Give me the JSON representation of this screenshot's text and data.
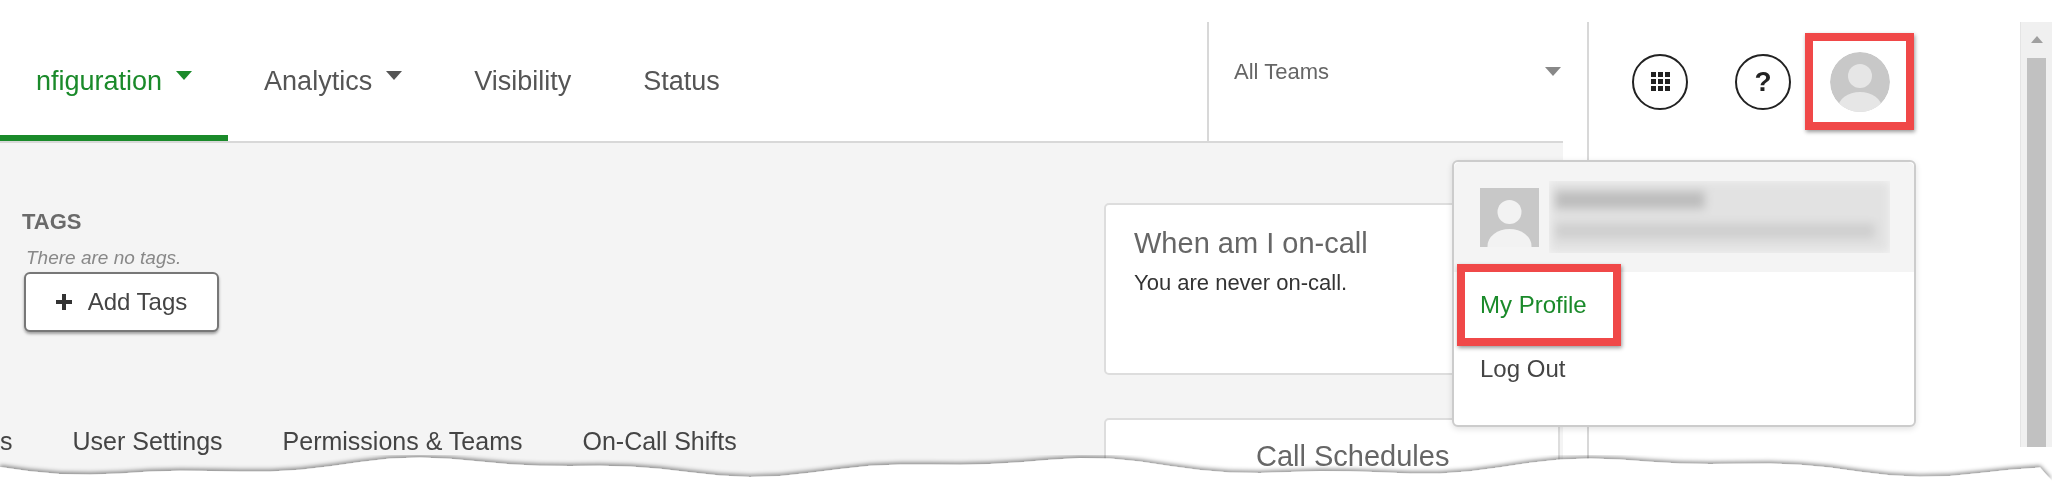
{
  "nav": {
    "tabs": [
      {
        "label": "nfiguration",
        "selected": true,
        "caret": true
      },
      {
        "label": "Analytics",
        "selected": false,
        "caret": true
      },
      {
        "label": "Visibility",
        "selected": false,
        "caret": false
      },
      {
        "label": "Status",
        "selected": false,
        "caret": false
      }
    ]
  },
  "team_filter": {
    "value": "All Teams"
  },
  "toolbar": {
    "help_label": "?",
    "avatar_highlighted": true
  },
  "tags": {
    "title": "TAGS",
    "empty_text": "There are no tags.",
    "button": "Add Tags"
  },
  "subtabs": [
    {
      "label": "s"
    },
    {
      "label": "User Settings"
    },
    {
      "label": "Permissions & Teams"
    },
    {
      "label": "On-Call Shifts"
    }
  ],
  "cards": [
    {
      "title": "When am I on-call",
      "text": "You are never on-call."
    },
    {
      "title": "Call Schedules"
    }
  ],
  "user_menu": {
    "items": [
      {
        "label": "My Profile",
        "active": true,
        "highlighted": true
      },
      {
        "label": "Log Out",
        "active": false,
        "highlighted": false
      }
    ]
  }
}
